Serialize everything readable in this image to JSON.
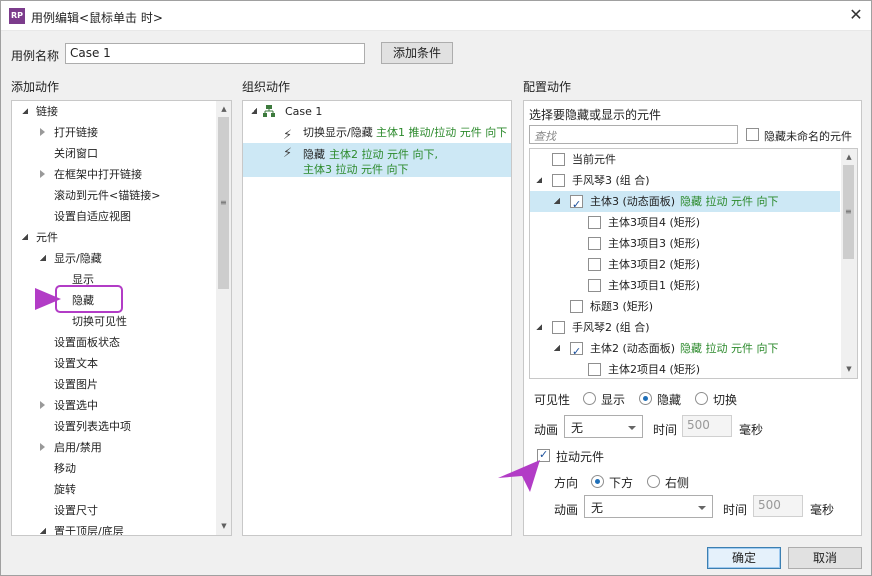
{
  "window": {
    "title": "用例编辑<鼠标单击 时>",
    "icon": "RP",
    "close": "✕"
  },
  "case_name": {
    "label": "用例名称",
    "value": "Case 1",
    "add_condition": "添加条件"
  },
  "add_action": {
    "heading": "添加动作",
    "items": [
      {
        "label": "链接"
      },
      {
        "label": "打开链接"
      },
      {
        "label": "关闭窗口"
      },
      {
        "label": "在框架中打开链接"
      },
      {
        "label": "滚动到元件<锚链接>"
      },
      {
        "label": "设置自适应视图"
      },
      {
        "label": "元件"
      },
      {
        "label": "显示/隐藏"
      },
      {
        "label": "显示"
      },
      {
        "label": "隐藏"
      },
      {
        "label": "切换可见性"
      },
      {
        "label": "设置面板状态"
      },
      {
        "label": "设置文本"
      },
      {
        "label": "设置图片"
      },
      {
        "label": "设置选中"
      },
      {
        "label": "设置列表选中项"
      },
      {
        "label": "启用/禁用"
      },
      {
        "label": "移动"
      },
      {
        "label": "旋转"
      },
      {
        "label": "设置尺寸"
      },
      {
        "label": "置于顶层/底层"
      }
    ]
  },
  "organize_action": {
    "heading": "组织动作",
    "case": "Case 1",
    "actions": [
      {
        "prefix": "切换显示/隐藏",
        "detail": "主体1 推动/拉动 元件 向下"
      },
      {
        "prefix": "隐藏",
        "detail": "主体2 拉动 元件 向下,",
        "detail2": "主体3 拉动 元件 向下"
      }
    ]
  },
  "configure_action": {
    "heading": "配置动作",
    "select_label": "选择要隐藏或显示的元件",
    "search_placeholder": "查找",
    "hide_unnamed": "隐藏未命名的元件",
    "tree": [
      {
        "label": "当前元件"
      },
      {
        "label": "手风琴3 (组 合)"
      },
      {
        "label": "主体3 (动态面板)",
        "action": "隐藏 拉动 元件 向下"
      },
      {
        "label": "主体3项目4 (矩形)"
      },
      {
        "label": "主体3项目3 (矩形)"
      },
      {
        "label": "主体3项目2 (矩形)"
      },
      {
        "label": "主体3项目1 (矩形)"
      },
      {
        "label": "标题3 (矩形)"
      },
      {
        "label": "手风琴2 (组 合)"
      },
      {
        "label": "主体2 (动态面板)",
        "action": "隐藏 拉动 元件 向下"
      },
      {
        "label": "主体2项目4 (矩形)"
      }
    ],
    "visibility": {
      "label": "可见性",
      "show": "显示",
      "hide": "隐藏",
      "toggle": "切换"
    },
    "animation": {
      "label": "动画",
      "value": "无",
      "time_label": "时间",
      "time_value": "500",
      "unit": "毫秒"
    },
    "pull": {
      "label": "拉动元件",
      "direction_label": "方向",
      "down": "下方",
      "right": "右侧",
      "anim_label": "动画",
      "anim_value": "无",
      "time_label": "时间",
      "time_value": "500",
      "unit": "毫秒"
    }
  },
  "footer": {
    "ok": "确定",
    "cancel": "取消"
  },
  "colors": {
    "annotation": "#b23cc6",
    "selection": "#cde8f5",
    "green": "#2c8a2c"
  }
}
